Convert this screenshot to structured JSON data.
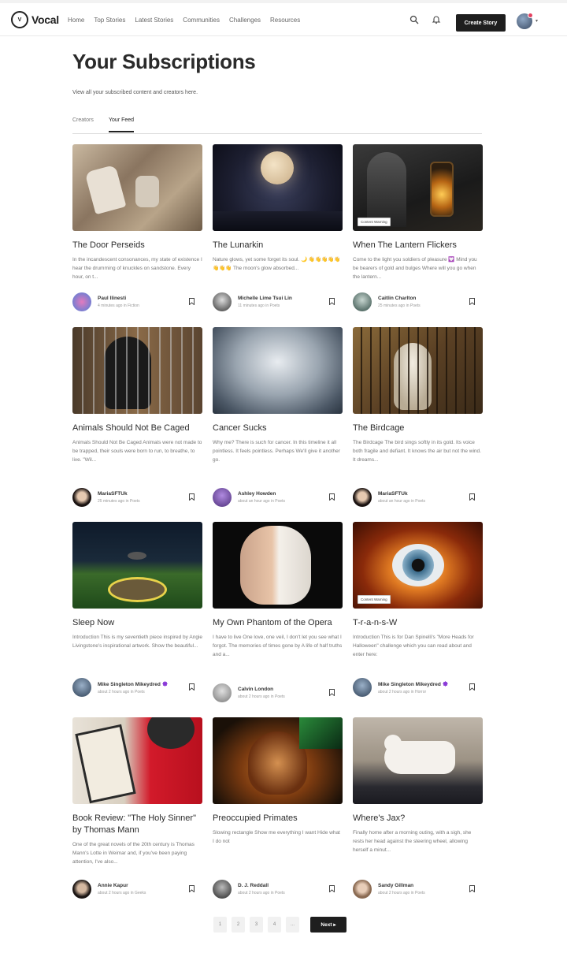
{
  "nav": {
    "logo_text": "Vocal",
    "links": [
      "Home",
      "Top Stories",
      "Latest Stories",
      "Communities",
      "Challenges",
      "Resources"
    ],
    "create_label": "Create Story"
  },
  "header": {
    "title": "Your Subscriptions",
    "subtitle": "View all your subscribed content and creators here.",
    "tabs": [
      "Creators",
      "Your Feed"
    ]
  },
  "cards": [
    {
      "title": "The Door Perseids",
      "excerpt": "In the incandescent consonances, my state of existence I hear the drumming of knuckles on sandstone. Every hour, on t...",
      "author": "Paul Ilinesti",
      "meta": "4 minutes ago in Fiction",
      "badge": "",
      "verified": false
    },
    {
      "title": "The Lunarkin",
      "excerpt": "Nature glows, yet some forget its soul. 🌙 👋👋👋👋👋👋👋👋 The moon's glow absorbed...",
      "author": "Michelle Lime Tsui Lin",
      "meta": "11 minutes ago in Poets",
      "badge": "",
      "verified": false
    },
    {
      "title": "When The Lantern Flickers",
      "excerpt": "Come to the light you soldiers of pleasure 💟 Mind you be bearers of gold and bulges Where will you go when the lantern...",
      "author": "Caitlin Charlton",
      "meta": "25 minutes ago in Poets",
      "badge": "Content Warning",
      "verified": false
    },
    {
      "title": "Animals Should Not Be Caged",
      "excerpt": "Animals Should Not Be Caged Animals were not made to be trapped, their souls were born to run, to breathe, to live. \"Wil...",
      "author": "MariaSFTUk",
      "meta": "25 minutes ago in Poets",
      "badge": "",
      "verified": false
    },
    {
      "title": "Cancer Sucks",
      "excerpt": "Why me? There is such for cancer. In this timeline it all pointless. It feels pointless. Perhaps We'll give it another go.",
      "author": "Ashley Howden",
      "meta": "about an hour ago in Poets",
      "badge": "",
      "verified": false
    },
    {
      "title": "The Birdcage",
      "excerpt": "The Birdcage The bird sings softly in its gold. Its voice both fragile and defiant. It knows the air but not the wind. It dreams...",
      "author": "MariaSFTUk",
      "meta": "about an hour ago in Poets",
      "badge": "",
      "verified": false
    },
    {
      "title": "Sleep Now",
      "excerpt": "Introduction This is my seventieth piece inspired by Angie Livingstone's inspirational artwork. Show the beautiful...",
      "author": "Mike Singleton Mikeydred",
      "meta": "about 2 hours ago in Poets",
      "badge": "",
      "verified": true
    },
    {
      "title": "My Own Phantom of the Opera",
      "excerpt": "I have to live One love, one veil, I don't let you see what I forgot. The memories of times gone by A life of half truths and a...",
      "author": "Calvin London",
      "meta": "about 2 hours ago in Poets",
      "badge": "",
      "verified": false
    },
    {
      "title": "T-r-a-n-s-W",
      "excerpt": "Introduction This is for Dan Spinelli's \"More Heads for Halloween\" challenge which you can read about and enter here:",
      "author": "Mike Singleton Mikeydred",
      "meta": "about 2 hours ago in Horror",
      "badge": "Content Warning",
      "verified": true
    },
    {
      "title": "Book Review: \"The Holy Sinner\" by Thomas Mann",
      "excerpt": "One of the great novels of the 20th century is Thomas Mann's Lotte in Weimar and, if you've been paying attention, I've also...",
      "author": "Annie Kapur",
      "meta": "about 2 hours ago in Geeks",
      "badge": "",
      "verified": false
    },
    {
      "title": "Preoccupied Primates",
      "excerpt": "Slowing rectangle Show me everything I want Hide what I do not",
      "author": "D. J. Reddall",
      "meta": "about 2 hours ago in Poets",
      "badge": "",
      "verified": false
    },
    {
      "title": "Where's Jax?",
      "excerpt": "Finally home after a morning outing, with a sigh, she rests her head against the steering wheel, allowing herself a minut...",
      "author": "Sandy Gillman",
      "meta": "about 2 hours ago in Poets",
      "badge": "",
      "verified": false
    }
  ],
  "pagination": {
    "pages": [
      "1",
      "2",
      "3",
      "4",
      "..."
    ],
    "next_label": "Next"
  }
}
